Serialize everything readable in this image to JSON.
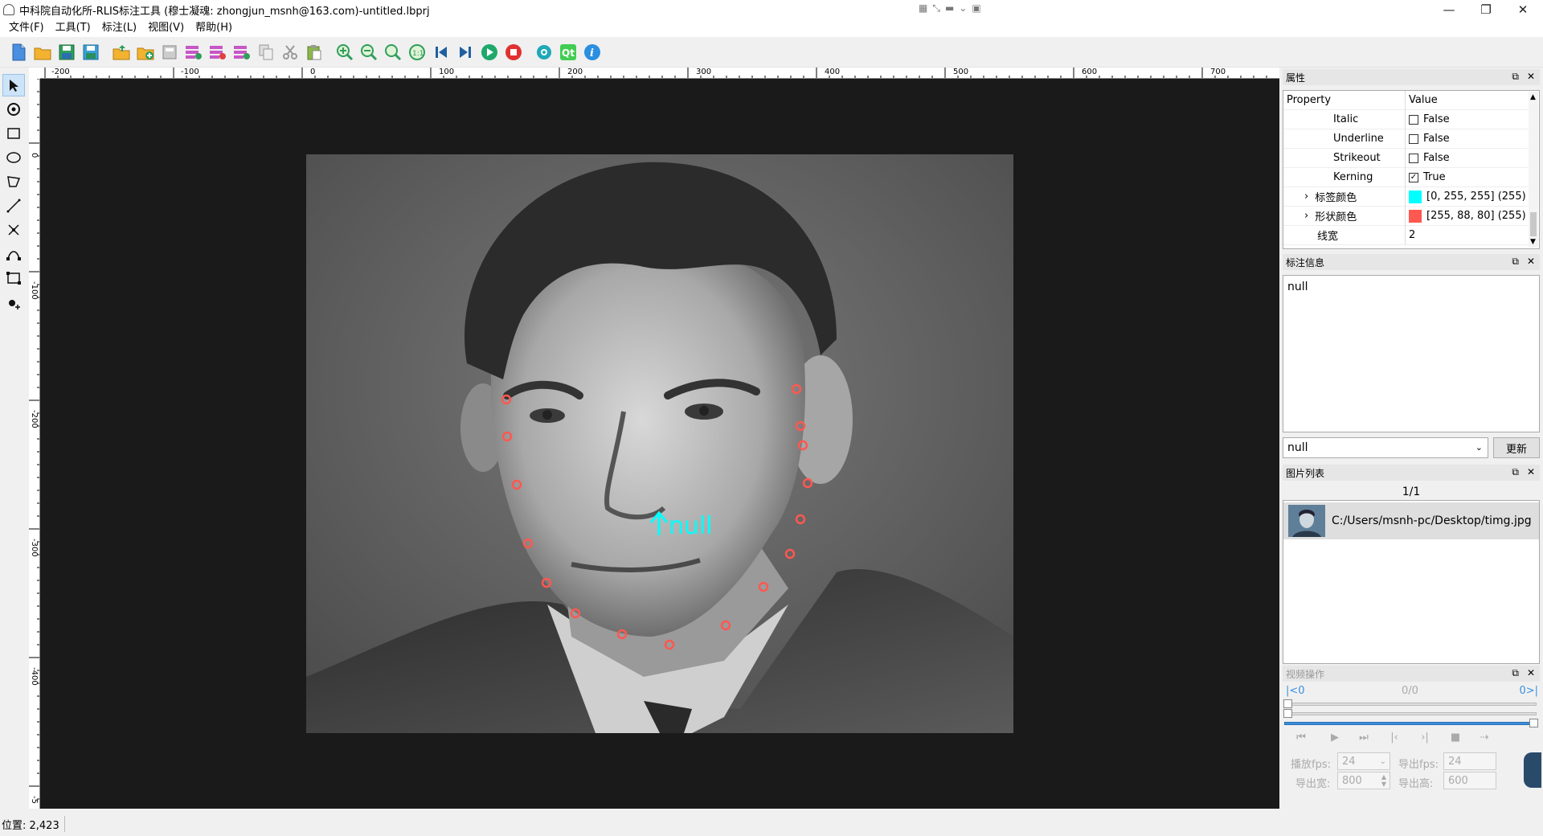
{
  "window": {
    "title": "中科院自动化所-RLIS标注工具 (穆士凝魂: zhongjun_msnh@163.com)-untitled.lbprj",
    "minimize": "—",
    "maximize": "❐",
    "close": "✕"
  },
  "menu": [
    "文件(F)",
    "工具(T)",
    "标注(L)",
    "视图(V)",
    "帮助(H)"
  ],
  "ruler": {
    "h_labels": [
      "-200",
      "-100",
      "0",
      "100",
      "200",
      "300",
      "400",
      "500",
      "600",
      "700"
    ],
    "v_labels": [
      "0",
      "-100",
      "-200",
      "-300",
      "-400",
      "-5"
    ]
  },
  "canvas": {
    "annotation_label": "null",
    "label_color": "#00ffff",
    "shape_color": "#ff5850"
  },
  "status": {
    "position": "位置: 2,423"
  },
  "properties": {
    "title": "属性",
    "header_property": "Property",
    "header_value": "Value",
    "rows": [
      {
        "name": "Italic",
        "value": "False",
        "checked": false
      },
      {
        "name": "Underline",
        "value": "False",
        "checked": false
      },
      {
        "name": "Strikeout",
        "value": "False",
        "checked": false
      },
      {
        "name": "Kerning",
        "value": "True",
        "checked": true
      },
      {
        "name": "标签颜色",
        "value": "[0, 255, 255] (255)",
        "color": "#00ffff"
      },
      {
        "name": "形状颜色",
        "value": "[255, 88, 80] (255)",
        "color": "#ff5850"
      },
      {
        "name": "线宽",
        "value": "2"
      }
    ]
  },
  "annotation_info": {
    "title": "标注信息",
    "text": "null",
    "selected_label": "null",
    "update_button": "更新"
  },
  "image_list": {
    "title": "图片列表",
    "counter": "1/1",
    "items": [
      {
        "path": "C:/Users/msnh-pc/Desktop/timg.jpg"
      }
    ]
  },
  "video": {
    "title": "视频操作",
    "start": "|<0",
    "current": "0/0",
    "end": "0>|",
    "play_fps_label": "播放fps:",
    "play_fps": "24",
    "export_fps_label": "导出fps:",
    "export_fps": "24",
    "export_width_label": "导出宽:",
    "export_width": "800",
    "export_height_label": "导出高:",
    "export_height": "600"
  }
}
